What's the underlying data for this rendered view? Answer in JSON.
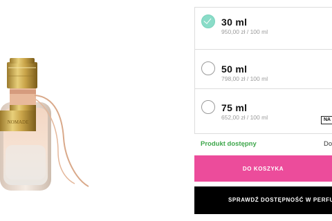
{
  "product": {
    "image_alt": "Chloé Nomade perfume bottle",
    "bottle_label": "NOMADE"
  },
  "sizes": [
    {
      "size": "30 ml",
      "price": "950,00 zł / 100 ml",
      "selected": true
    },
    {
      "size": "50 ml",
      "price": "798,00 zł / 100 ml",
      "selected": false
    },
    {
      "size": "75 ml",
      "price": "652,00 zł / 100 ml",
      "selected": false
    }
  ],
  "badge": "NA",
  "availability": {
    "status": "Produkt dostępny",
    "delivery": "Do",
    "status_color": "#3ca64a"
  },
  "actions": {
    "add_to_cart": "DO KOSZYKA",
    "check_in_store": "SPRAWDŹ DOSTĘPNOŚĆ W PERFU",
    "cart_color": "#ec4c9b"
  },
  "icons": {
    "selected_radio": "checkmark-icon"
  }
}
